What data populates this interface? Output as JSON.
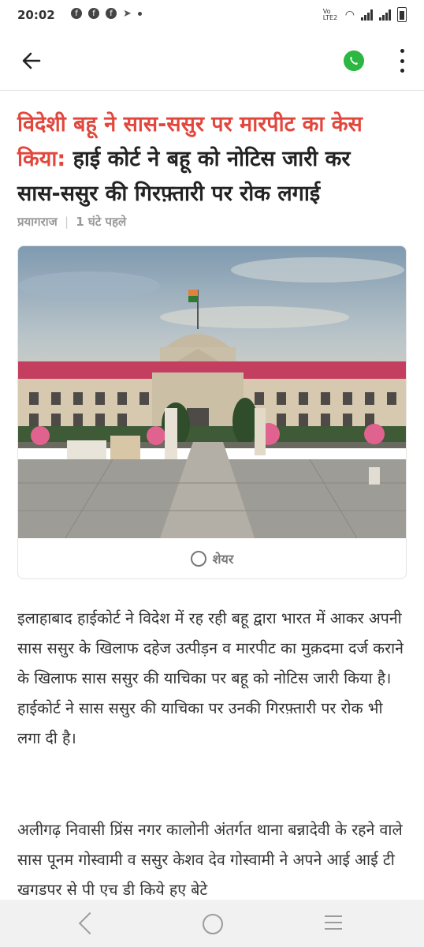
{
  "status_bar": {
    "time": "20:02",
    "network_label": "Vo LTE2",
    "notifications": [
      "facebook-icon",
      "facebook-icon",
      "facebook-icon",
      "telegram-icon"
    ]
  },
  "app_bar": {
    "back_icon": "arrow-left-icon",
    "share_icon": "whatsapp-icon",
    "menu_icon": "more-vertical-icon",
    "whatsapp_color": "#2bb741"
  },
  "article": {
    "headline_highlight": "विदेशी बहू ने सास-ससुर पर मारपीट का केस किया:",
    "headline_rest": " हाई कोर्ट ने बहू को नोटिस जारी कर सास-ससुर की गिरफ़्तारी पर रोक लगाई",
    "highlight_color": "#e2473d",
    "location": "प्रयागराज",
    "separator": "|",
    "time_ago": "1 घंटे पहले",
    "share_label": "शेयर",
    "paragraphs": [
      "इलाहाबाद हाईकोर्ट ने विदेश में रह रही बहू द्वारा भारत में आकर अपनी सास ससुर के खिलाफ दहेज उत्पीड़न व मारपीट का मुक़दमा दर्ज कराने के खिलाफ सास ससुर की याचिका पर बहू को नोटिस जारी किया है। हाईकोर्ट ने सास ससुर की याचिका पर उनकी गिरफ़्तारी पर रोक भी लगा दी है।",
      "अलीगढ़ निवासी प्रिंस नगर कालोनी अंतर्गत थाना बन्नादेवी के रहने वाले सास पूनम गोस्वामी व ससुर केशव देव गोस्वामी ने अपने आई आई टी खगडपर से पी एच डी किये हए बेटे"
    ]
  },
  "nav_bar": {
    "icons": [
      "nav-back-icon",
      "nav-home-icon",
      "nav-recent-icon"
    ]
  }
}
